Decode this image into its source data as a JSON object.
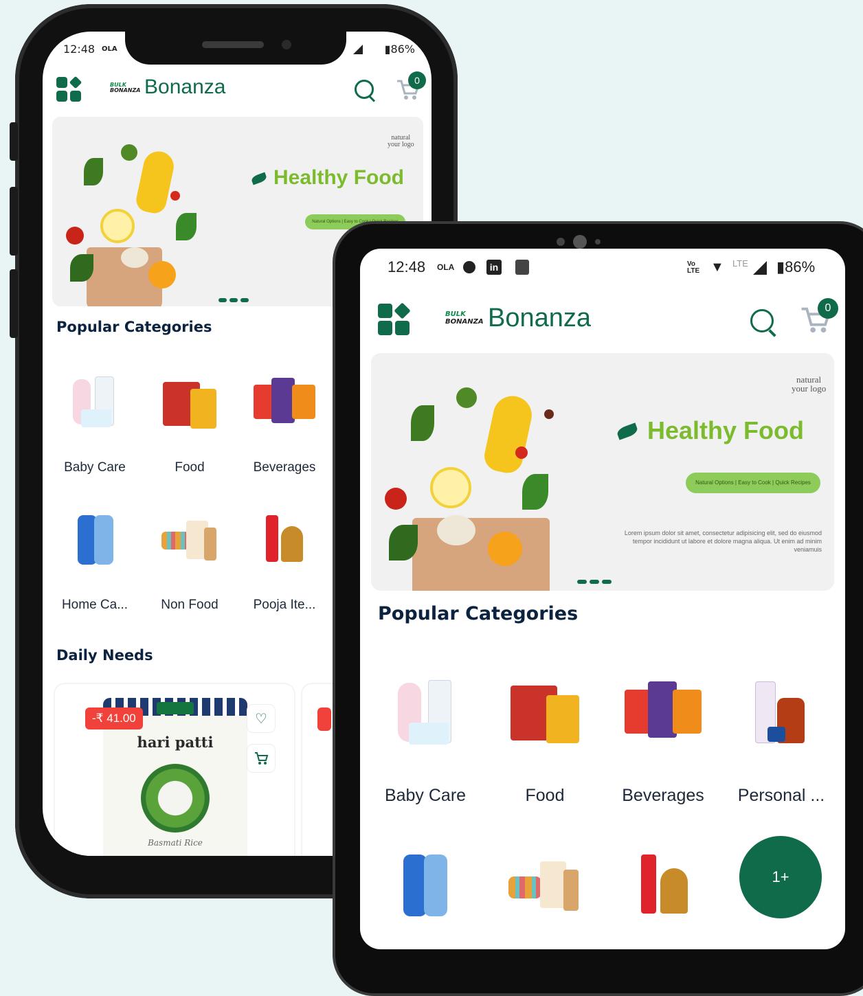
{
  "status": {
    "time": "12:48",
    "carrier": "OLA",
    "volte": "Vo LTE",
    "lte": "LTE",
    "battery": "86%"
  },
  "header": {
    "brand_top": "BULK",
    "brand_bottom": "BONANZA",
    "brand_name": "Bonanza",
    "cart_count": "0"
  },
  "banner": {
    "title": "Healthy Food",
    "logo_line1": "natural",
    "logo_line2": "your logo",
    "tagline": "Natural Options | Easy to Cook | Quick Recipes",
    "lorem_phone": "Lorem ipsum dolor sit amet, c\neiusmod tempor incididunt ut l",
    "lorem_tablet": "Lorem ipsum dolor sit amet, consectetur adipisicing elit, sed do eiusmod tempor incididunt ut labore et dolore magna aliqua. Ut enim ad minim veniamuis"
  },
  "popular_categories": {
    "title": "Popular Categories",
    "phone_items": [
      "Baby Care",
      "Food",
      "Beverages",
      "Home Ca...",
      "Non Food",
      "Pooja Ite..."
    ],
    "tablet_items": [
      "Baby Care",
      "Food",
      "Beverages",
      "Personal ..."
    ]
  },
  "daily_needs": {
    "title": "Daily Needs",
    "product": {
      "discount": "-₹ 41.00",
      "brand": "hari patti",
      "variant": "Basmati Rice"
    }
  },
  "fab_label": "1+",
  "colors": {
    "brand_green": "#0f6b4a",
    "heading_navy": "#0c2340",
    "discount_red": "#f0413a",
    "healthy_green": "#7dbb2e"
  }
}
